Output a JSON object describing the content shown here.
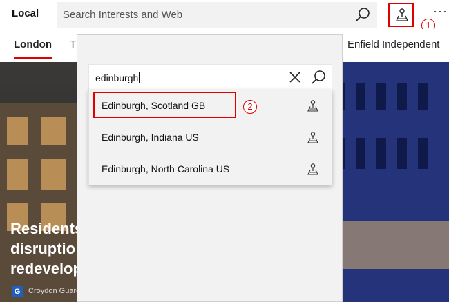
{
  "app": {
    "title": "Local"
  },
  "search": {
    "placeholder": "Search Interests and Web"
  },
  "header": {
    "more_label": "···"
  },
  "tabs": [
    {
      "label": "London",
      "active": true
    },
    {
      "label": "T"
    },
    {
      "label": "Enfield Independent"
    }
  ],
  "hero": {
    "title_lines": [
      "Residents",
      "disruptio",
      "redevelop"
    ],
    "source_logo": "G",
    "source_name": "Croydon Guardian"
  },
  "location_search": {
    "value": "edinburgh",
    "results": [
      {
        "label": "Edinburgh, Scotland GB"
      },
      {
        "label": "Edinburgh, Indiana US"
      },
      {
        "label": "Edinburgh, North Carolina US"
      }
    ]
  },
  "annotations": {
    "callout_1": "1",
    "callout_2": "2"
  },
  "colors": {
    "accent": "#e00000",
    "flyout_bg": "#f2f2f2",
    "search_bg": "#f2f2f2"
  },
  "icons": [
    "search-icon",
    "location-pin-icon",
    "more-icon",
    "close-icon"
  ]
}
